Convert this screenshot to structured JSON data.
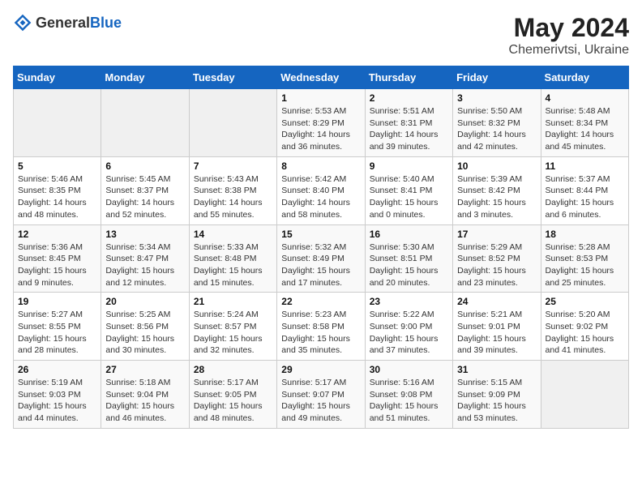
{
  "header": {
    "logo_general": "General",
    "logo_blue": "Blue",
    "month": "May 2024",
    "location": "Chemerivtsi, Ukraine"
  },
  "weekdays": [
    "Sunday",
    "Monday",
    "Tuesday",
    "Wednesday",
    "Thursday",
    "Friday",
    "Saturday"
  ],
  "weeks": [
    [
      {
        "day": "",
        "info": ""
      },
      {
        "day": "",
        "info": ""
      },
      {
        "day": "",
        "info": ""
      },
      {
        "day": "1",
        "info": "Sunrise: 5:53 AM\nSunset: 8:29 PM\nDaylight: 14 hours\nand 36 minutes."
      },
      {
        "day": "2",
        "info": "Sunrise: 5:51 AM\nSunset: 8:31 PM\nDaylight: 14 hours\nand 39 minutes."
      },
      {
        "day": "3",
        "info": "Sunrise: 5:50 AM\nSunset: 8:32 PM\nDaylight: 14 hours\nand 42 minutes."
      },
      {
        "day": "4",
        "info": "Sunrise: 5:48 AM\nSunset: 8:34 PM\nDaylight: 14 hours\nand 45 minutes."
      }
    ],
    [
      {
        "day": "5",
        "info": "Sunrise: 5:46 AM\nSunset: 8:35 PM\nDaylight: 14 hours\nand 48 minutes."
      },
      {
        "day": "6",
        "info": "Sunrise: 5:45 AM\nSunset: 8:37 PM\nDaylight: 14 hours\nand 52 minutes."
      },
      {
        "day": "7",
        "info": "Sunrise: 5:43 AM\nSunset: 8:38 PM\nDaylight: 14 hours\nand 55 minutes."
      },
      {
        "day": "8",
        "info": "Sunrise: 5:42 AM\nSunset: 8:40 PM\nDaylight: 14 hours\nand 58 minutes."
      },
      {
        "day": "9",
        "info": "Sunrise: 5:40 AM\nSunset: 8:41 PM\nDaylight: 15 hours\nand 0 minutes."
      },
      {
        "day": "10",
        "info": "Sunrise: 5:39 AM\nSunset: 8:42 PM\nDaylight: 15 hours\nand 3 minutes."
      },
      {
        "day": "11",
        "info": "Sunrise: 5:37 AM\nSunset: 8:44 PM\nDaylight: 15 hours\nand 6 minutes."
      }
    ],
    [
      {
        "day": "12",
        "info": "Sunrise: 5:36 AM\nSunset: 8:45 PM\nDaylight: 15 hours\nand 9 minutes."
      },
      {
        "day": "13",
        "info": "Sunrise: 5:34 AM\nSunset: 8:47 PM\nDaylight: 15 hours\nand 12 minutes."
      },
      {
        "day": "14",
        "info": "Sunrise: 5:33 AM\nSunset: 8:48 PM\nDaylight: 15 hours\nand 15 minutes."
      },
      {
        "day": "15",
        "info": "Sunrise: 5:32 AM\nSunset: 8:49 PM\nDaylight: 15 hours\nand 17 minutes."
      },
      {
        "day": "16",
        "info": "Sunrise: 5:30 AM\nSunset: 8:51 PM\nDaylight: 15 hours\nand 20 minutes."
      },
      {
        "day": "17",
        "info": "Sunrise: 5:29 AM\nSunset: 8:52 PM\nDaylight: 15 hours\nand 23 minutes."
      },
      {
        "day": "18",
        "info": "Sunrise: 5:28 AM\nSunset: 8:53 PM\nDaylight: 15 hours\nand 25 minutes."
      }
    ],
    [
      {
        "day": "19",
        "info": "Sunrise: 5:27 AM\nSunset: 8:55 PM\nDaylight: 15 hours\nand 28 minutes."
      },
      {
        "day": "20",
        "info": "Sunrise: 5:25 AM\nSunset: 8:56 PM\nDaylight: 15 hours\nand 30 minutes."
      },
      {
        "day": "21",
        "info": "Sunrise: 5:24 AM\nSunset: 8:57 PM\nDaylight: 15 hours\nand 32 minutes."
      },
      {
        "day": "22",
        "info": "Sunrise: 5:23 AM\nSunset: 8:58 PM\nDaylight: 15 hours\nand 35 minutes."
      },
      {
        "day": "23",
        "info": "Sunrise: 5:22 AM\nSunset: 9:00 PM\nDaylight: 15 hours\nand 37 minutes."
      },
      {
        "day": "24",
        "info": "Sunrise: 5:21 AM\nSunset: 9:01 PM\nDaylight: 15 hours\nand 39 minutes."
      },
      {
        "day": "25",
        "info": "Sunrise: 5:20 AM\nSunset: 9:02 PM\nDaylight: 15 hours\nand 41 minutes."
      }
    ],
    [
      {
        "day": "26",
        "info": "Sunrise: 5:19 AM\nSunset: 9:03 PM\nDaylight: 15 hours\nand 44 minutes."
      },
      {
        "day": "27",
        "info": "Sunrise: 5:18 AM\nSunset: 9:04 PM\nDaylight: 15 hours\nand 46 minutes."
      },
      {
        "day": "28",
        "info": "Sunrise: 5:17 AM\nSunset: 9:05 PM\nDaylight: 15 hours\nand 48 minutes."
      },
      {
        "day": "29",
        "info": "Sunrise: 5:17 AM\nSunset: 9:07 PM\nDaylight: 15 hours\nand 49 minutes."
      },
      {
        "day": "30",
        "info": "Sunrise: 5:16 AM\nSunset: 9:08 PM\nDaylight: 15 hours\nand 51 minutes."
      },
      {
        "day": "31",
        "info": "Sunrise: 5:15 AM\nSunset: 9:09 PM\nDaylight: 15 hours\nand 53 minutes."
      },
      {
        "day": "",
        "info": ""
      }
    ]
  ]
}
